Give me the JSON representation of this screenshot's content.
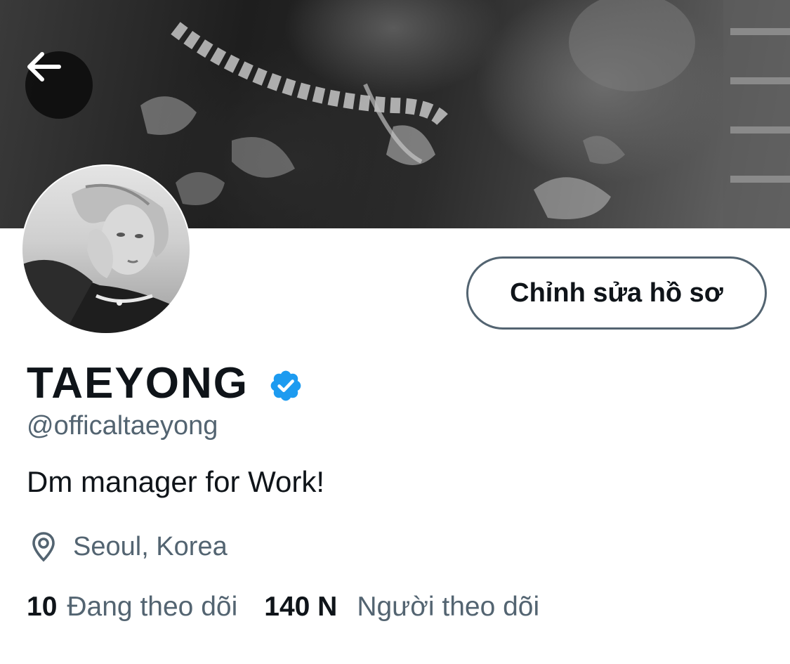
{
  "header": {
    "back_icon": "arrow-left-icon"
  },
  "profile": {
    "display_name": "TAEYONG",
    "verified_icon": "verified-badge-icon",
    "handle": "@officaltaeyong",
    "bio": "Dm manager for Work!",
    "location_icon": "location-pin-icon",
    "location": "Seoul, Korea",
    "edit_button_label": "Chỉnh sửa hồ sơ"
  },
  "stats": {
    "following_count": "10",
    "following_label": "Đang theo dõi",
    "followers_count": "140 N",
    "followers_label": "Người theo dõi"
  },
  "colors": {
    "verified_blue": "#1d9bf0",
    "primary_text": "#0f1419",
    "secondary_text": "#536471"
  }
}
